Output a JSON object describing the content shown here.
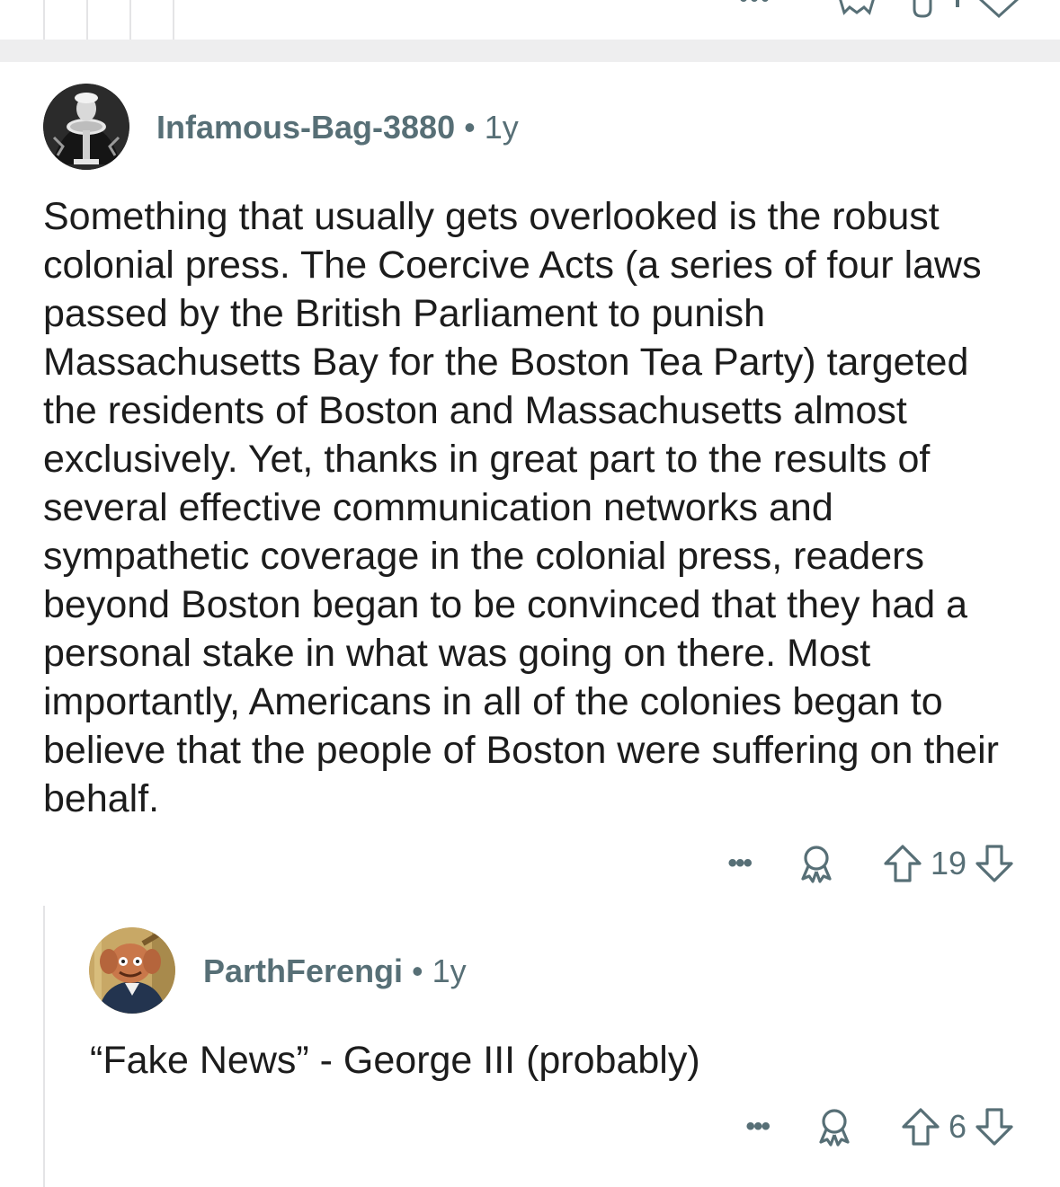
{
  "comments": [
    {
      "author": "Infamous-Bag-3880",
      "separator": "•",
      "age": "1y",
      "body": "Something that usually gets overlooked is the robust colonial press. The Coercive Acts (a series of four laws passed by the British Parliament to punish Massachusetts Bay for the Boston Tea Party) targeted the residents of Boston and Massachusetts almost exclusively. Yet, thanks in great part to the results of several effective communication networks and sympathetic coverage in the colonial press, readers beyond Boston began to be convinced that they had a personal stake in what was going on there. Most importantly, Americans in all of the colonies began to believe that the people of Boston were suffering on their behalf.",
      "more_label": "•••",
      "score": "19"
    },
    {
      "author": "ParthFerengi",
      "separator": "•",
      "age": "1y",
      "body": "“Fake News” - George III (probably)",
      "more_label": "•••",
      "score": "6"
    }
  ],
  "icons": {
    "award": "award-icon",
    "upvote": "upvote-arrow-icon",
    "downvote": "downvote-arrow-icon",
    "more": "more-options-icon"
  },
  "colors": {
    "meta_text": "#576f76",
    "body_text": "#1c1c1c",
    "divider": "#eeeeef",
    "thread_line": "#e4e4e6"
  }
}
